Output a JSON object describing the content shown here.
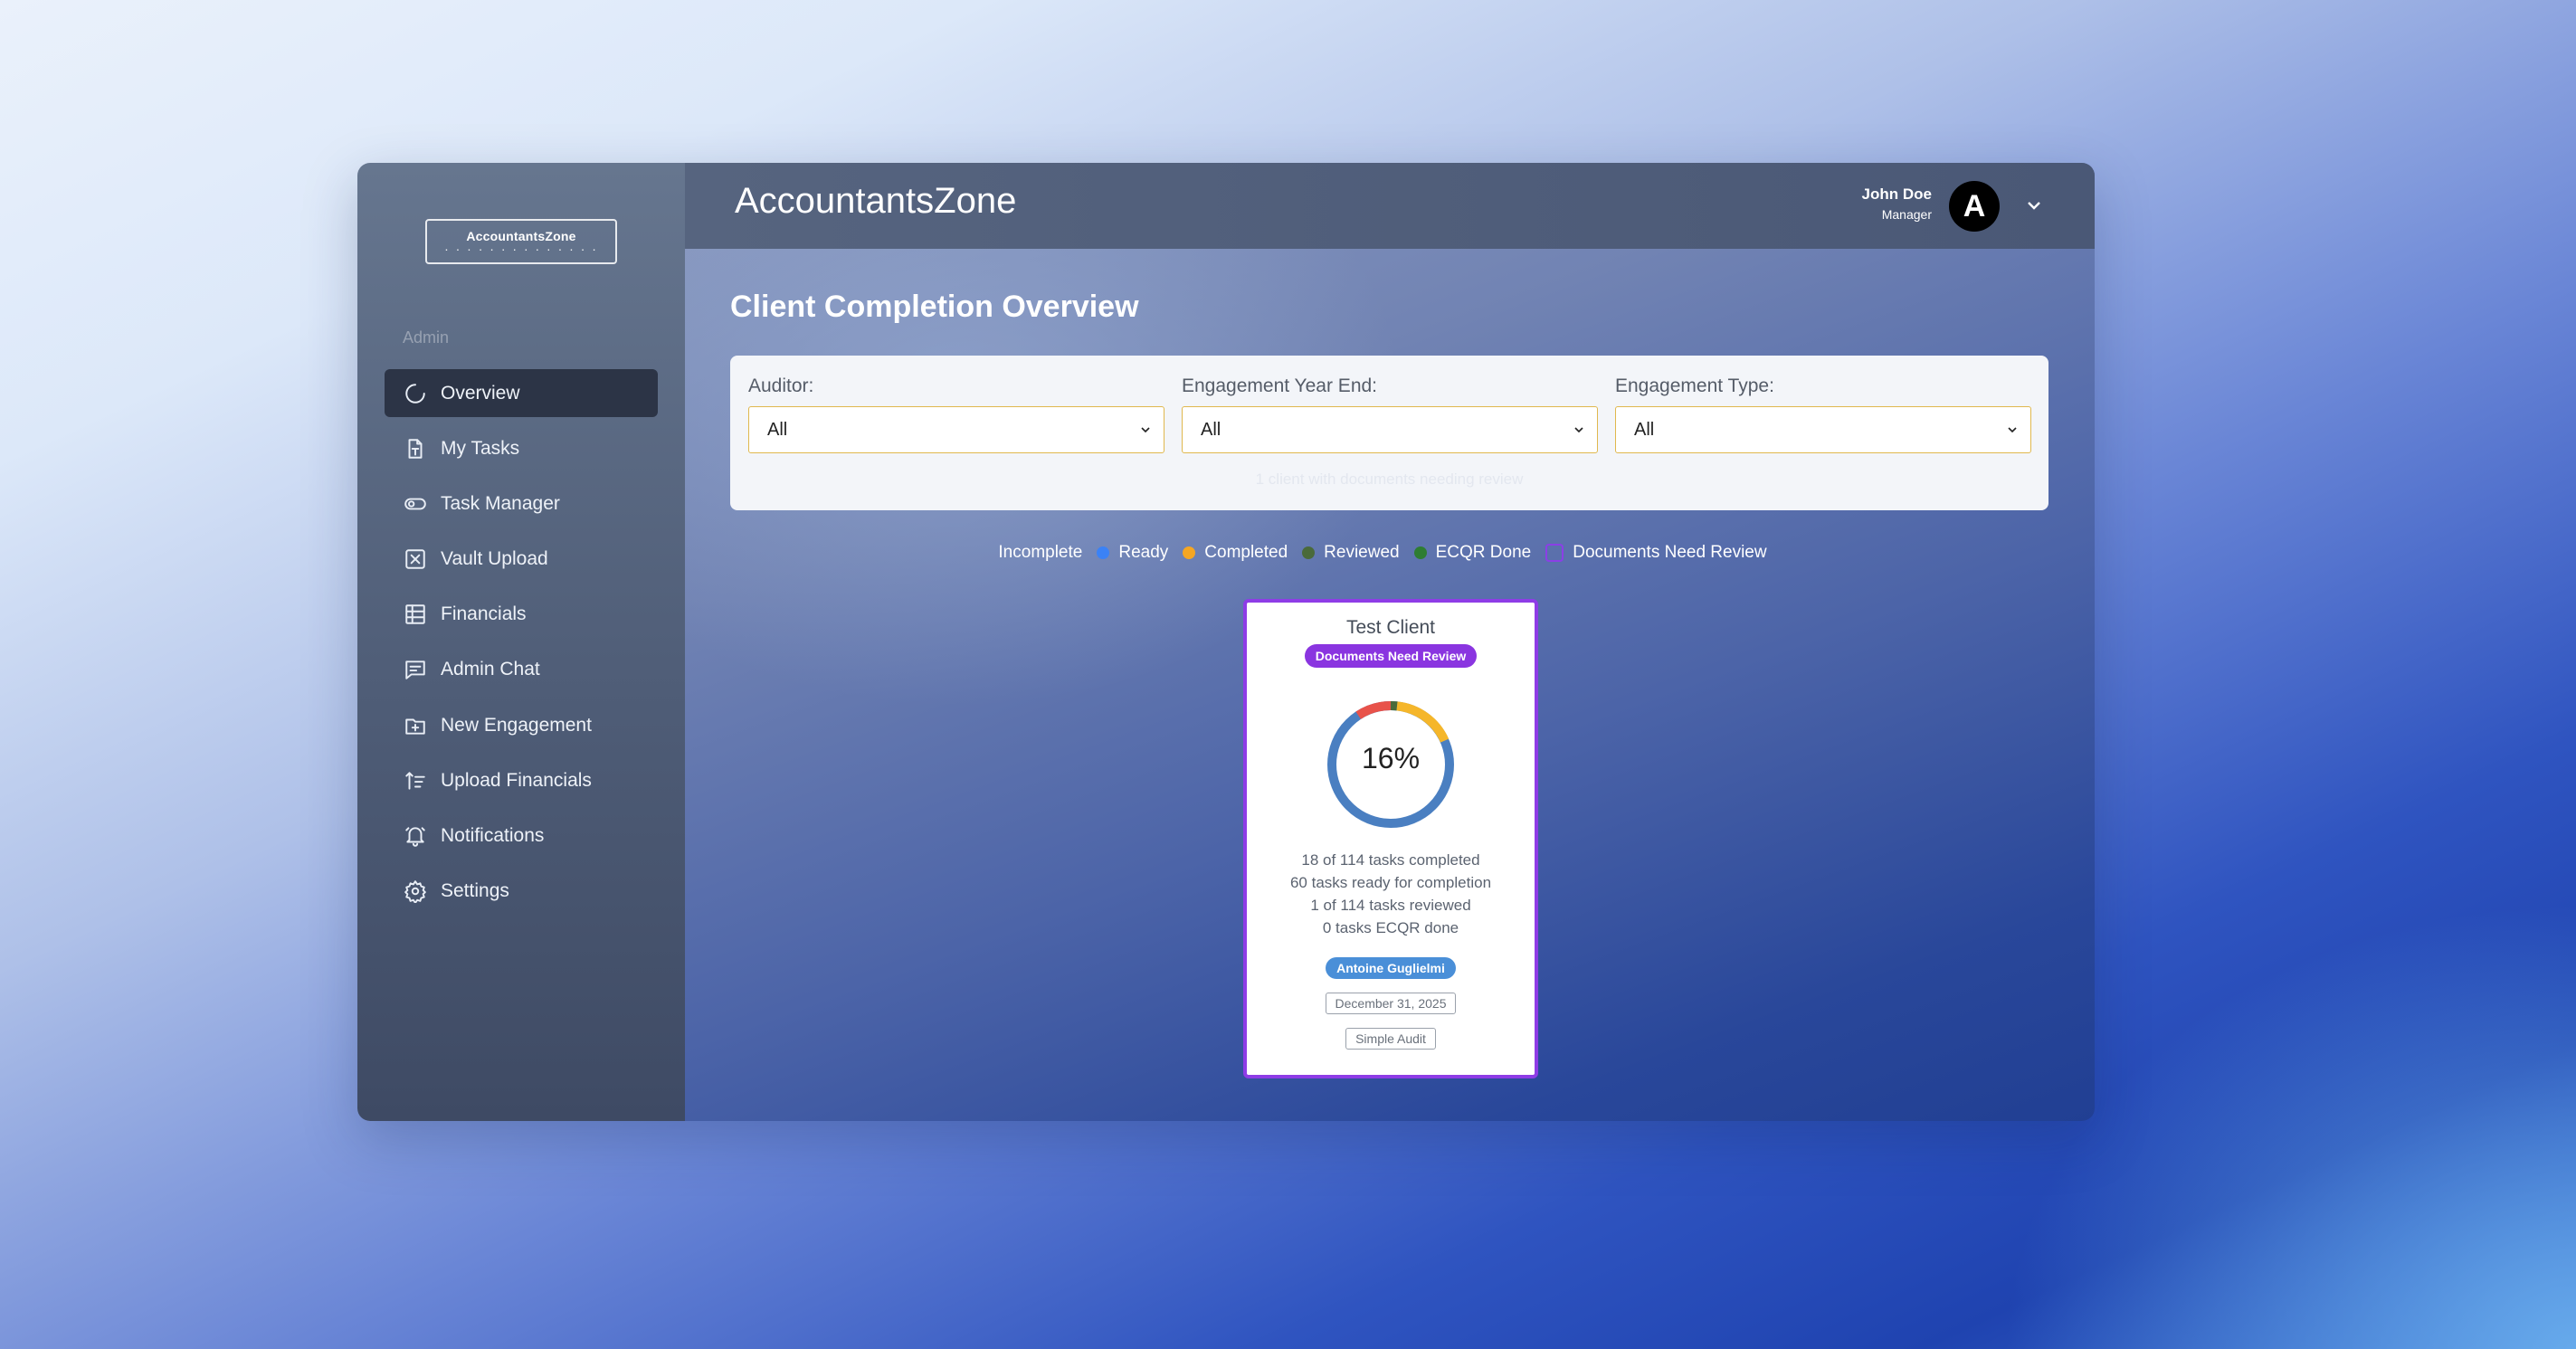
{
  "sidebar": {
    "logo_title": "AccountantsZone",
    "logo_dots": "· · · · · · · · · · · ·   · ·",
    "section_label": "Admin",
    "items": [
      {
        "label": "Overview",
        "icon": "loader-icon",
        "active": true
      },
      {
        "label": "My Tasks",
        "icon": "task-file-icon"
      },
      {
        "label": "Task Manager",
        "icon": "toggle-icon"
      },
      {
        "label": "Vault Upload",
        "icon": "vault-icon"
      },
      {
        "label": "Financials",
        "icon": "table-icon"
      },
      {
        "label": "Admin Chat",
        "icon": "chat-icon"
      },
      {
        "label": "New Engagement",
        "icon": "folder-plus-icon"
      },
      {
        "label": "Upload Financials",
        "icon": "upload-sort-icon"
      },
      {
        "label": "Notifications",
        "icon": "bell-icon"
      },
      {
        "label": "Settings",
        "icon": "gear-icon"
      }
    ]
  },
  "header": {
    "app_title": "AccountantsZone",
    "user_name": "John Doe",
    "user_role": "Manager",
    "avatar_letter": "A"
  },
  "main": {
    "page_title": "Client Completion Overview",
    "filters": [
      {
        "label": "Auditor:",
        "value": "All"
      },
      {
        "label": "Engagement Year End:",
        "value": "All"
      },
      {
        "label": "Engagement Type:",
        "value": "All"
      }
    ],
    "filter_note": "1 client with documents needing review",
    "legend": [
      {
        "label": "Incomplete",
        "color": "#ffffff"
      },
      {
        "label": "Ready",
        "color": "#3b82f6"
      },
      {
        "label": "Completed",
        "color": "#f5a623"
      },
      {
        "label": "Reviewed",
        "color": "#4a6a3a"
      },
      {
        "label": "ECQR Done",
        "color": "#2e7d32"
      },
      {
        "label": "Documents Need Review",
        "color": "#8b3fe6"
      }
    ],
    "card": {
      "client_name": "Test Client",
      "status_badge": "Documents Need Review",
      "percent_label": "16%",
      "percent": 16,
      "stats": [
        "18 of 114 tasks completed",
        "60 tasks ready for completion",
        "1 of 114 tasks reviewed",
        "0 tasks ECQR done"
      ],
      "auditor": "Antoine Guglielmi",
      "year_end": "December 31, 2025",
      "engagement_type": "Simple Audit"
    }
  }
}
